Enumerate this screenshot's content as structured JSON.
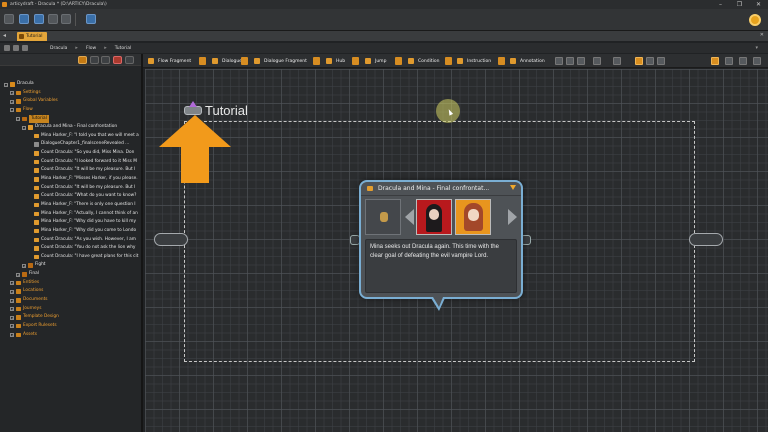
{
  "window": {
    "title": "articydraft - Dracula * (D:\\ARTICY\\Dracula\\)",
    "controls": [
      "–",
      "❐",
      "✕"
    ]
  },
  "tab": {
    "label": "Tutorial"
  },
  "breadcrumb": {
    "items": [
      "Dracula",
      "Flow",
      "Tutorial"
    ]
  },
  "node_toolbar": {
    "items": [
      "Flow Fragment",
      "Dialogue",
      "Dialogue Fragment",
      "Hub",
      "Jump",
      "Condition",
      "Instruction",
      "Annotation"
    ]
  },
  "tree": {
    "rows": [
      {
        "label": "Dracula",
        "depth": 0,
        "icon": "project",
        "orange": false,
        "expand": "−"
      },
      {
        "label": "Settings",
        "depth": 1,
        "icon": "folder",
        "orange": true,
        "expand": "+"
      },
      {
        "label": "Global Variables",
        "depth": 1,
        "icon": "folder",
        "orange": true,
        "expand": "+"
      },
      {
        "label": "Flow",
        "depth": 1,
        "icon": "folder",
        "orange": true,
        "expand": "−"
      },
      {
        "label": "Tutorial",
        "depth": 2,
        "icon": "frag",
        "orange": false,
        "expand": "−",
        "selected": true
      },
      {
        "label": "Dracula and Mina - Final confrontation",
        "depth": 3,
        "icon": "dlg",
        "orange": false,
        "expand": "−"
      },
      {
        "label": "Mina Harker_F: \"I told you that we will meet a",
        "depth": 4,
        "icon": "dlg",
        "orange": false
      },
      {
        "label": "DialogueChapter1_finalsceneRevealed ...",
        "depth": 4,
        "icon": "gray",
        "orange": false
      },
      {
        "label": "Count Dracula: \"So you did, Miss Mina.  Don",
        "depth": 4,
        "icon": "dlg",
        "orange": false
      },
      {
        "label": "Count Dracula: \"I looked forward to it Miss M",
        "depth": 4,
        "icon": "dlg",
        "orange": false
      },
      {
        "label": "Count Dracula: \"It will be my pleasure. But I",
        "depth": 4,
        "icon": "dlg",
        "orange": false
      },
      {
        "label": "Mina Harker_F: \"Misses Harker, if you please.",
        "depth": 4,
        "icon": "dlg",
        "orange": false
      },
      {
        "label": "Count Dracula: \"It will be my pleasure. But I",
        "depth": 4,
        "icon": "dlg",
        "orange": false
      },
      {
        "label": "Count Dracula: \"What do you want to know?",
        "depth": 4,
        "icon": "dlg",
        "orange": false
      },
      {
        "label": "Mina Harker_F: \"There is only one question I",
        "depth": 4,
        "icon": "dlg",
        "orange": false
      },
      {
        "label": "Mina Harker_F: \"Actually, I cannot think of an",
        "depth": 4,
        "icon": "dlg",
        "orange": false
      },
      {
        "label": "Mina Harker_F: \"Why did you have to kill my",
        "depth": 4,
        "icon": "dlg",
        "orange": false
      },
      {
        "label": "Mina Harker_F: \"Why did you come to Londo",
        "depth": 4,
        "icon": "dlg",
        "orange": false
      },
      {
        "label": "Count Dracula: \"As you wish. However, I am",
        "depth": 4,
        "icon": "dlg",
        "orange": false
      },
      {
        "label": "Count Dracula: \"You do not ask the lion why",
        "depth": 4,
        "icon": "dlg",
        "orange": false
      },
      {
        "label": "Count Dracula: \"I have great plans for this cit",
        "depth": 4,
        "icon": "dlg",
        "orange": false
      },
      {
        "label": "Fight",
        "depth": 3,
        "icon": "frag",
        "orange": false,
        "expand": "+"
      },
      {
        "label": "Final",
        "depth": 2,
        "icon": "frag",
        "orange": false,
        "expand": "+"
      },
      {
        "label": "Entities",
        "depth": 1,
        "icon": "folder",
        "orange": true,
        "expand": "+"
      },
      {
        "label": "Locations",
        "depth": 1,
        "icon": "folder",
        "orange": true,
        "expand": "+"
      },
      {
        "label": "Documents",
        "depth": 1,
        "icon": "folder",
        "orange": true,
        "expand": "+"
      },
      {
        "label": "Journeys",
        "depth": 1,
        "icon": "folder",
        "orange": true,
        "expand": "+"
      },
      {
        "label": "Template Design",
        "depth": 1,
        "icon": "folder",
        "orange": true,
        "expand": "+"
      },
      {
        "label": "Export Rulesets",
        "depth": 1,
        "icon": "folder",
        "orange": true,
        "expand": "+"
      },
      {
        "label": "Assets",
        "depth": 1,
        "icon": "folder",
        "orange": true,
        "expand": "+"
      }
    ]
  },
  "canvas": {
    "flow_title": "Tutorial",
    "node": {
      "title": "Dracula and Mina - Final confrontat...",
      "text": "Mina seeks out Dracula again. This time with the clear goal of defeating the evil vampire Lord."
    }
  },
  "colors": {
    "accent": "#e3a53a",
    "node_border": "#7aaed3",
    "arrow": "#f29a1b"
  }
}
